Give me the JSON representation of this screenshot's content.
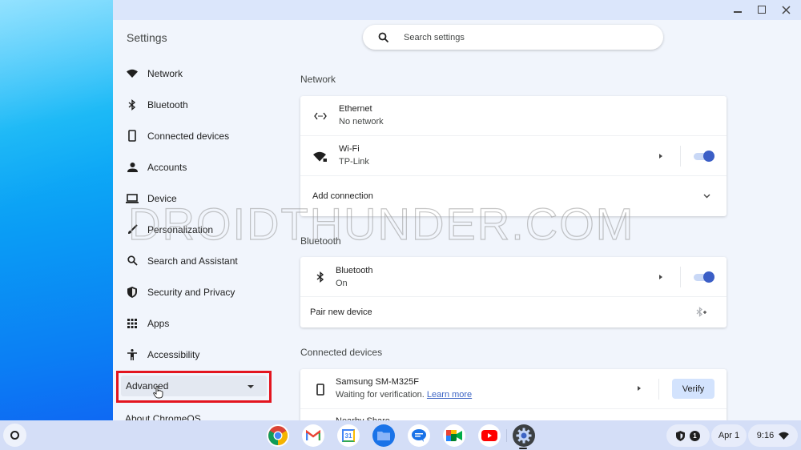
{
  "window": {
    "app_title": "Settings",
    "controls": [
      "minimize-icon",
      "maximize-icon",
      "close-icon"
    ]
  },
  "search": {
    "placeholder": "Search settings",
    "value": ""
  },
  "sidebar": {
    "items": [
      {
        "label": "Network",
        "icon": "wifi-icon"
      },
      {
        "label": "Bluetooth",
        "icon": "bluetooth-icon"
      },
      {
        "label": "Connected devices",
        "icon": "phone-icon"
      },
      {
        "label": "Accounts",
        "icon": "person-icon"
      },
      {
        "label": "Device",
        "icon": "laptop-icon"
      },
      {
        "label": "Personalization",
        "icon": "brush-icon"
      },
      {
        "label": "Search and Assistant",
        "icon": "search-icon"
      },
      {
        "label": "Security and Privacy",
        "icon": "shield-icon"
      },
      {
        "label": "Apps",
        "icon": "apps-grid-icon"
      },
      {
        "label": "Accessibility",
        "icon": "accessibility-icon"
      }
    ],
    "advanced_label": "Advanced",
    "about_label": "About ChromeOS"
  },
  "main": {
    "network": {
      "title": "Network",
      "ethernet": {
        "name": "Ethernet",
        "status": "No network"
      },
      "wifi": {
        "name": "Wi-Fi",
        "status": "TP-Link",
        "enabled": true
      },
      "add_connection": "Add connection"
    },
    "bluetooth": {
      "title": "Bluetooth",
      "bluetooth": {
        "name": "Bluetooth",
        "status": "On",
        "enabled": true
      },
      "pair_new": "Pair new device"
    },
    "connected_devices": {
      "title": "Connected devices",
      "device": {
        "name": "Samsung SM-M325F",
        "status": "Waiting for verification.",
        "learn_more": "Learn more",
        "verify_label": "Verify"
      },
      "next_item_partial": "Nearby Share"
    }
  },
  "watermark": "DROIDTHUNDER.COM",
  "shelf": {
    "apps": [
      "Chrome",
      "Gmail",
      "Calendar",
      "Files",
      "Messages",
      "Google Meet",
      "YouTube",
      "Settings"
    ],
    "calendar_day": "31",
    "tray": {
      "notification_count": "1",
      "date": "Apr 1",
      "time": "9:16"
    }
  },
  "colors": {
    "accent": "#3b5ec6",
    "toggle_track": "#c9d8f6",
    "verify_bg": "#d3e3fd",
    "highlight_border": "#e3151f",
    "window_bg": "#f1f5fc",
    "titlebar_bg": "#dbe6fb"
  }
}
